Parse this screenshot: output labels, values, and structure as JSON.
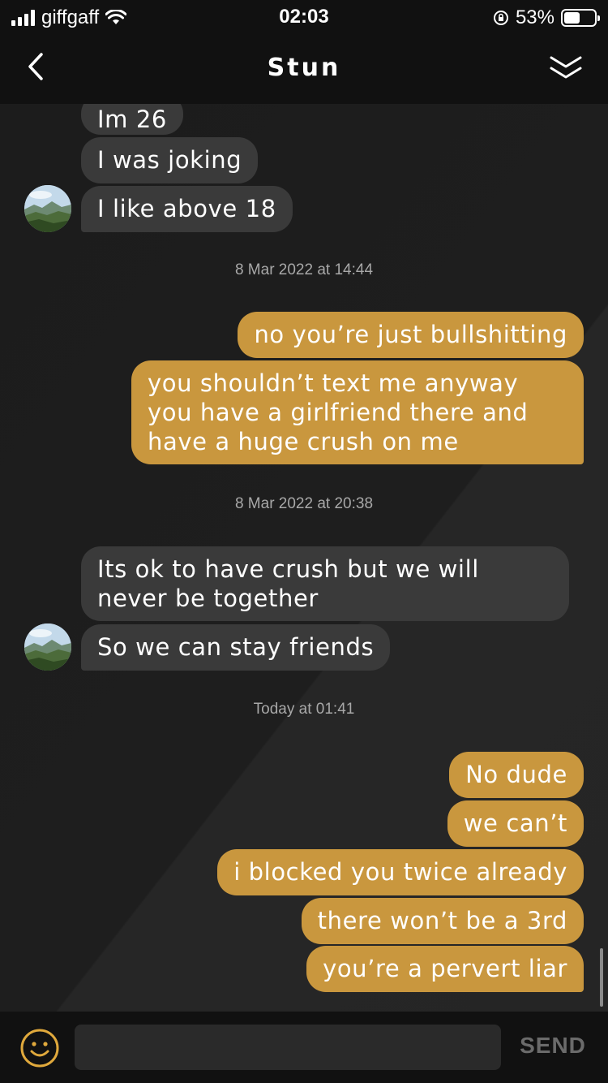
{
  "status_bar": {
    "carrier": "giffgaff",
    "time": "02:03",
    "battery": "53%",
    "battery_level": 0.53
  },
  "header": {
    "title": "Stun",
    "back_icon": "chevron-left-icon",
    "collapse_icon": "double-chevron-down-icon"
  },
  "messages": {
    "in_1": "Im 26",
    "in_2": "I was joking",
    "in_3": "I like above 18",
    "stamp_1": "8 Mar 2022 at 14:44",
    "out_1": "no you’re just bullshitting",
    "out_2": "you shouldn’t text me anyway you have a girlfriend there and have a huge crush on me",
    "stamp_2": "8 Mar 2022 at 20:38",
    "in_4": "Its ok to have crush but we will never be together",
    "in_5": "So we can stay friends",
    "stamp_3": "Today at 01:41",
    "out_3": "No dude",
    "out_4": "we can’t",
    "out_5": "i blocked you twice already",
    "out_6": "there won’t be a 3rd",
    "out_7": "you’re a pervert liar"
  },
  "composer": {
    "placeholder": "",
    "send_label": "SEND",
    "emoji_icon": "smiley-icon"
  },
  "colors": {
    "outgoing_bubble": "#c9973e",
    "incoming_bubble": "#3a3a3a",
    "accent": "#e0a93c"
  }
}
